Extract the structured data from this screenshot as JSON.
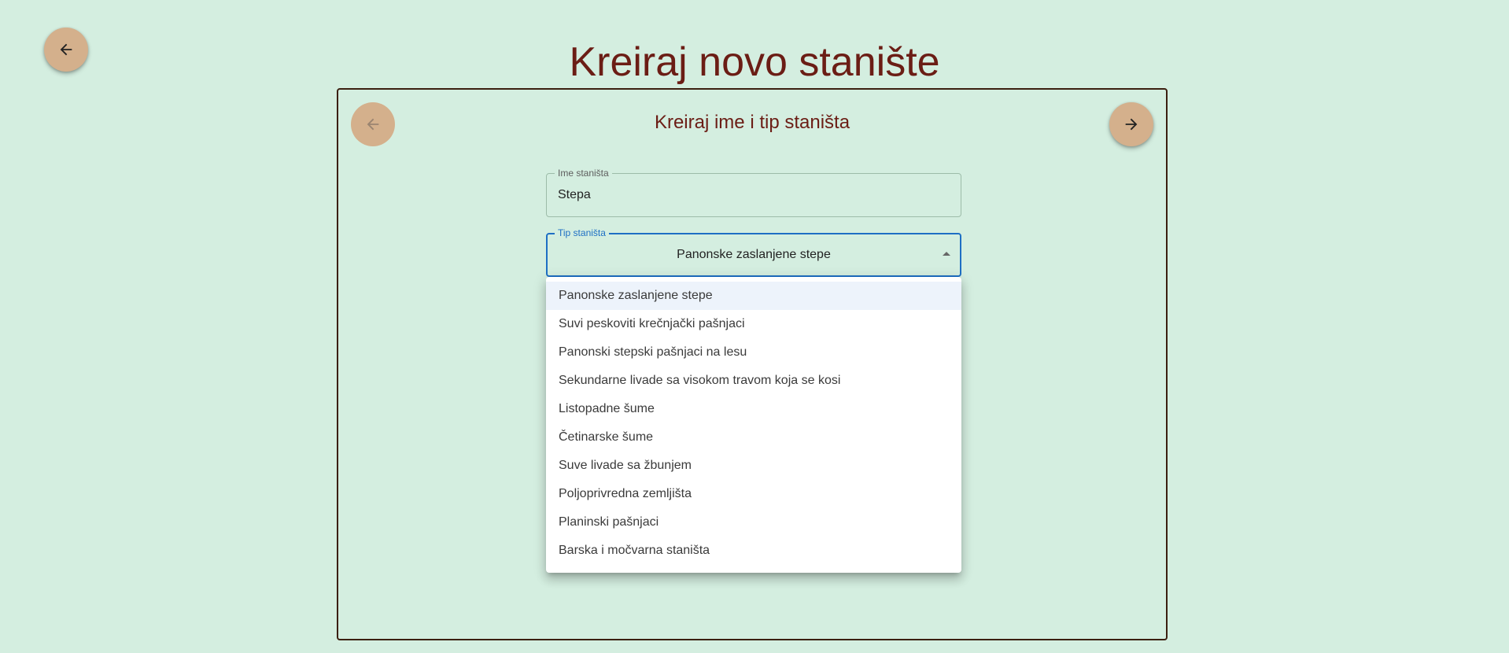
{
  "page": {
    "title": "Kreiraj novo stanište"
  },
  "step": {
    "title": "Kreiraj ime i tip staništa"
  },
  "form": {
    "name_label": "Ime staništa",
    "name_value": "Stepa",
    "type_label": "Tip staništa",
    "type_value": "Panonske zaslanjene stepe"
  },
  "dropdown": {
    "options": [
      "Panonske zaslanjene stepe",
      "Suvi peskoviti krečnjački pašnjaci",
      "Panonski stepski pašnjaci na lesu",
      "Sekundarne livade sa visokom travom koja se kosi",
      "Listopadne šume",
      "Četinarske šume",
      "Suve livade sa žbunjem",
      "Poljoprivredna zemljišta",
      "Planinski pašnjaci",
      "Barska i močvarna staništa"
    ],
    "selected_index": 0
  },
  "icons": {
    "back": "arrow-left-icon",
    "prev": "arrow-left-icon",
    "next": "arrow-right-icon",
    "caret": "caret-up-icon"
  },
  "colors": {
    "background": "#d4eee0",
    "accent_button": "#d4b08c",
    "title": "#6b1d15",
    "focus": "#1e6fc4"
  }
}
